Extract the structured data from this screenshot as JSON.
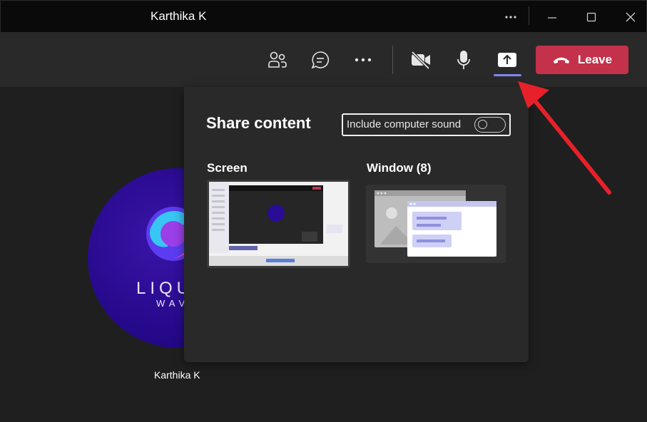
{
  "window": {
    "title": "Karthika K",
    "controls": [
      "more-options",
      "minimize",
      "maximize",
      "close"
    ]
  },
  "toolbar": {
    "buttons": [
      "people",
      "chat",
      "more-actions",
      "camera-off",
      "mic",
      "share-content"
    ],
    "active": "share-content",
    "leave_label": "Leave",
    "leave_color": "#c4314b",
    "accent_color": "#7f85f5"
  },
  "participant": {
    "name": "Karthika K",
    "avatar_text": "LIQU",
    "avatar_subtext": "WAV",
    "avatar_color": "#2a0c95"
  },
  "share_panel": {
    "title": "Share content",
    "include_sound_label": "Include computer sound",
    "include_sound_on": false,
    "screen_label": "Screen",
    "window_label": "Window (8)"
  },
  "annotation": {
    "arrow_color": "#e8202a",
    "points_to": "share-content"
  }
}
